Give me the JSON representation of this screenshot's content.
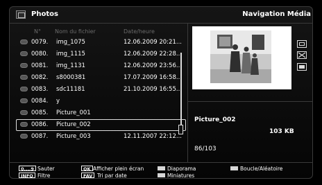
{
  "header": {
    "title": "Photos",
    "section": "Navigation Média"
  },
  "columns": {
    "num": "N°",
    "name": "Nom du fichier",
    "date": "Date/heure"
  },
  "files": [
    {
      "num": "0079.",
      "name": "img_1075",
      "date": "12.06.2009 20:21..."
    },
    {
      "num": "0080.",
      "name": "img_1115",
      "date": "12.06.2009 22:28..."
    },
    {
      "num": "0081.",
      "name": "img_1131",
      "date": "12.06.2009 23:56..."
    },
    {
      "num": "0082.",
      "name": "s8000381",
      "date": "17.07.2009 16:58..."
    },
    {
      "num": "0083.",
      "name": "sdc11181",
      "date": "21.10.2009 16:55..."
    },
    {
      "num": "0084.",
      "name": "y",
      "date": ""
    },
    {
      "num": "0085.",
      "name": "Picture_001",
      "date": ""
    },
    {
      "num": "0086.",
      "name": "Picture_002",
      "date": "",
      "selected": true
    },
    {
      "num": "0087.",
      "name": "Picture_003",
      "date": "12.11.2007 22:12..."
    }
  ],
  "info": {
    "name": "Picture_002",
    "size": "103 KB",
    "count": "86/103"
  },
  "footer": {
    "key_numbers": "0....9",
    "key_numbers_label": "Sauter",
    "key_info": "INFO",
    "key_info_label": "Filtre",
    "key_ok": "OK",
    "key_ok_label": "Afficher plein écran",
    "key_fav": "FAV",
    "key_fav_label": "Tri par date",
    "color_slideshow": "Diaporama",
    "color_thumbnails": "Miniatures",
    "color_loop": "Boucle/Aléatoire"
  },
  "icons": {
    "app": "photos-app-icon",
    "side": [
      "fullscreen-icon",
      "shuffle-icon",
      "stop-icon"
    ]
  }
}
